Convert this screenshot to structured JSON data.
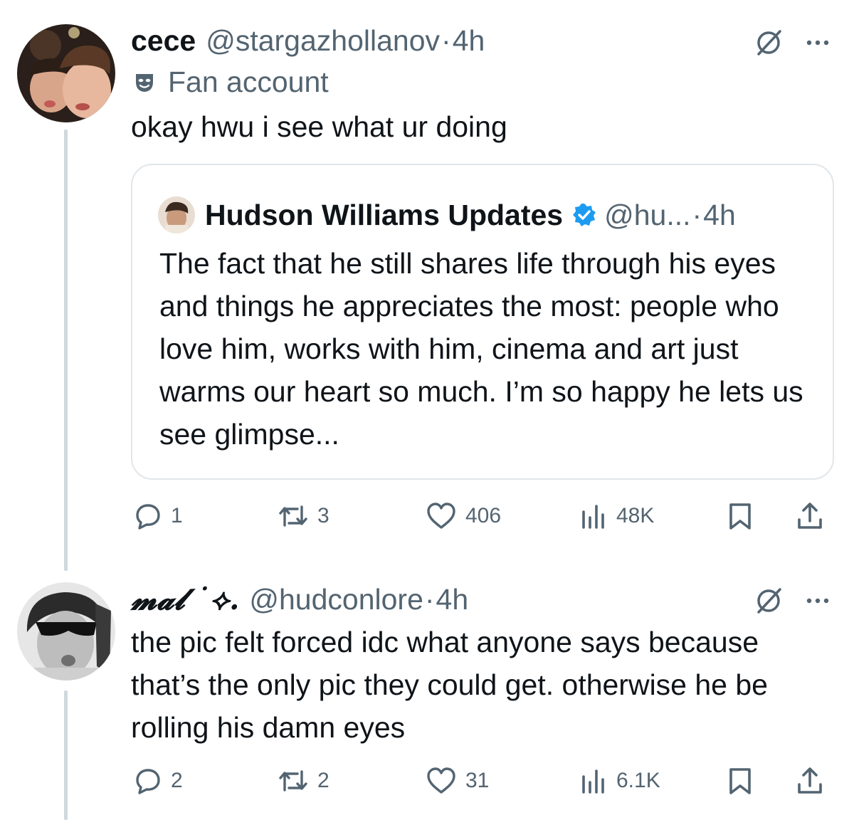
{
  "tweets": [
    {
      "display_name": "cece",
      "handle": "@stargazhollanov",
      "time": "4h",
      "badge": "Fan account",
      "text": "okay hwu i see what ur doing",
      "quote": {
        "display_name": "Hudson Williams Updates",
        "handle": "@hu...",
        "time": "4h",
        "verified": true,
        "text": "The fact that he still shares life through his eyes and things he appreciates the most: people who love him, works with him, cinema and art just warms our heart so much. I’m so happy he lets us see glimpse..."
      },
      "actions": {
        "replies": "1",
        "reposts": "3",
        "likes": "406",
        "views": "48K"
      }
    },
    {
      "display_name": "𝓶𝓪𝓵 ˙⟡.",
      "handle": "@hudconlore",
      "time": "4h",
      "text": "the pic felt forced idc what anyone says because that’s the only pic they could get. otherwise he be rolling his damn eyes",
      "actions": {
        "replies": "2",
        "reposts": "2",
        "likes": "31",
        "views": "6.1K"
      }
    }
  ],
  "separator_dot": "·",
  "icons": {
    "badge": "theater-mask-icon",
    "hide": "slashed-circle-icon",
    "more": "more-dots-icon",
    "reply": "reply-icon",
    "repost": "repost-icon",
    "like": "heart-icon",
    "views": "views-icon",
    "bookmark": "bookmark-icon",
    "share": "share-icon",
    "verified": "verified-badge-icon"
  },
  "colors": {
    "text": "#0f1419",
    "secondary": "#536471",
    "verified": "#1d9bf0",
    "thread_line": "#cfd9de"
  }
}
